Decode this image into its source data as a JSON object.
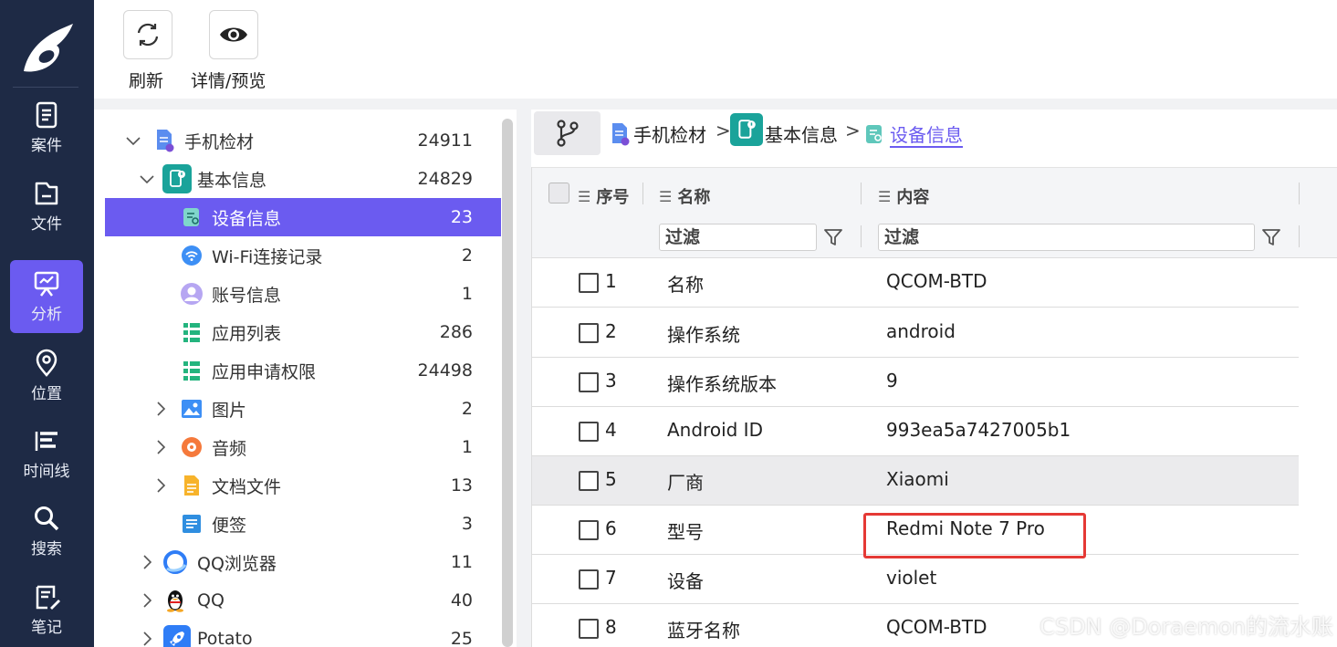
{
  "nav": {
    "items": [
      {
        "label": "案件",
        "icon": "case-icon"
      },
      {
        "label": "文件",
        "icon": "folder-icon"
      },
      {
        "label": "分析",
        "icon": "analysis-icon",
        "active": true
      },
      {
        "label": "位置",
        "icon": "location-pin-icon"
      },
      {
        "label": "时间线",
        "icon": "timeline-icon"
      },
      {
        "label": "搜索",
        "icon": "search-icon"
      },
      {
        "label": "笔记",
        "icon": "note-icon"
      }
    ]
  },
  "toolbar": {
    "refresh_label": "刷新",
    "detail_label": "详情/预览"
  },
  "tree": {
    "items": [
      {
        "label": "手机检材",
        "count": "24911"
      },
      {
        "label": "基本信息",
        "count": "24829"
      },
      {
        "label": "设备信息",
        "count": "23"
      },
      {
        "label": "Wi-Fi连接记录",
        "count": "2"
      },
      {
        "label": "账号信息",
        "count": "1"
      },
      {
        "label": "应用列表",
        "count": "286"
      },
      {
        "label": "应用申请权限",
        "count": "24498"
      },
      {
        "label": "图片",
        "count": "2"
      },
      {
        "label": "音频",
        "count": "1"
      },
      {
        "label": "文档文件",
        "count": "13"
      },
      {
        "label": "便签",
        "count": "3"
      },
      {
        "label": "QQ浏览器",
        "count": "11"
      },
      {
        "label": "QQ",
        "count": "40"
      },
      {
        "label": "Potato",
        "count": "25"
      }
    ]
  },
  "breadcrumb": {
    "items": [
      "手机检材",
      "基本信息",
      "设备信息"
    ],
    "separator": ">"
  },
  "grid": {
    "columns": {
      "index": "序号",
      "name": "名称",
      "content": "内容"
    },
    "filter_placeholder": "过滤",
    "rows": [
      {
        "index": "1",
        "name": "名称",
        "content": "QCOM-BTD"
      },
      {
        "index": "2",
        "name": "操作系统",
        "content": "android"
      },
      {
        "index": "3",
        "name": "操作系统版本",
        "content": "9"
      },
      {
        "index": "4",
        "name": "Android ID",
        "content": "993ea5a7427005b1"
      },
      {
        "index": "5",
        "name": "厂商",
        "content": "Xiaomi"
      },
      {
        "index": "6",
        "name": "型号",
        "content": "Redmi Note 7 Pro"
      },
      {
        "index": "7",
        "name": "设备",
        "content": "violet"
      },
      {
        "index": "8",
        "name": "蓝牙名称",
        "content": "QCOM-BTD"
      }
    ]
  },
  "watermark": "CSDN @Doraemon的流水账",
  "colors": {
    "accent": "#6b5bf0",
    "nav_bg": "#1e2a45",
    "highlight": "#e53935"
  }
}
